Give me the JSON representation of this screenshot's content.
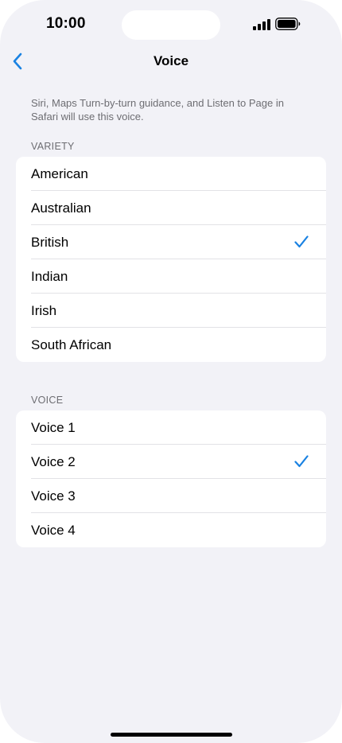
{
  "status": {
    "time": "10:00"
  },
  "nav": {
    "title": "Voice",
    "back_icon": "chevron-left-icon"
  },
  "description": "Siri, Maps Turn-by-turn guidance, and Listen to Page in Safari will use this voice.",
  "variety": {
    "header": "VARIETY",
    "items": [
      {
        "label": "American",
        "selected": false
      },
      {
        "label": "Australian",
        "selected": false
      },
      {
        "label": "British",
        "selected": true
      },
      {
        "label": "Indian",
        "selected": false
      },
      {
        "label": "Irish",
        "selected": false
      },
      {
        "label": "South African",
        "selected": false
      }
    ]
  },
  "voice": {
    "header": "VOICE",
    "items": [
      {
        "label": "Voice 1",
        "selected": false
      },
      {
        "label": "Voice 2",
        "selected": true
      },
      {
        "label": "Voice 3",
        "selected": false
      },
      {
        "label": "Voice 4",
        "selected": false
      }
    ]
  },
  "colors": {
    "accent": "#1a82e2",
    "background": "#f2f2f7",
    "secondary_text": "#6d6d72"
  }
}
